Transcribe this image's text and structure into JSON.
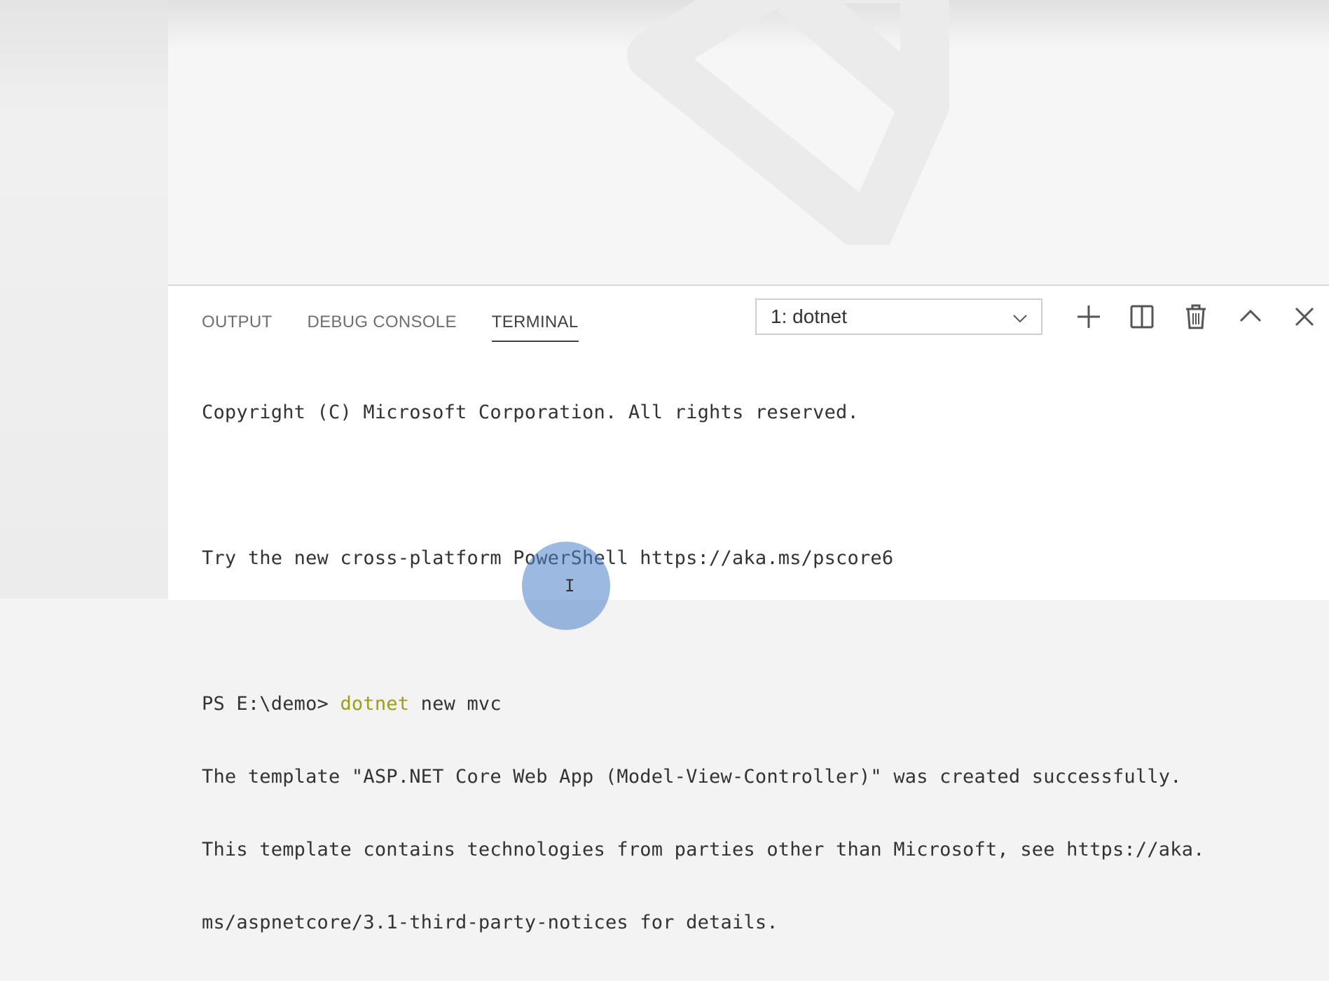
{
  "panel": {
    "tabs": [
      {
        "label": "OUTPUT",
        "active": false
      },
      {
        "label": "DEBUG CONSOLE",
        "active": false
      },
      {
        "label": "TERMINAL",
        "active": true
      }
    ],
    "terminal_select": {
      "value": "1: dotnet"
    },
    "toolbar_icons": [
      "plus-icon",
      "split-icon",
      "trash-icon",
      "chevron-up-icon",
      "close-icon"
    ]
  },
  "terminal": {
    "line1": "Copyright (C) Microsoft Corporation. All rights reserved.",
    "line2": "Try the new cross-platform PowerShell https://aka.ms/pscore6",
    "prompt": "PS E:\\demo> ",
    "cmd_name": "dotnet",
    "cmd_args": " new mvc",
    "line4": "The template \"ASP.NET Core Web App (Model-View-Controller)\" was created successfully.",
    "line5": "This template contains technologies from parties other than Microsoft, see https://aka.",
    "line6": "ms/aspnetcore/3.1-third-party-notices for details."
  },
  "colors": {
    "command_highlight": "#9c9e14",
    "cursor_highlight": "#4a82c8"
  }
}
